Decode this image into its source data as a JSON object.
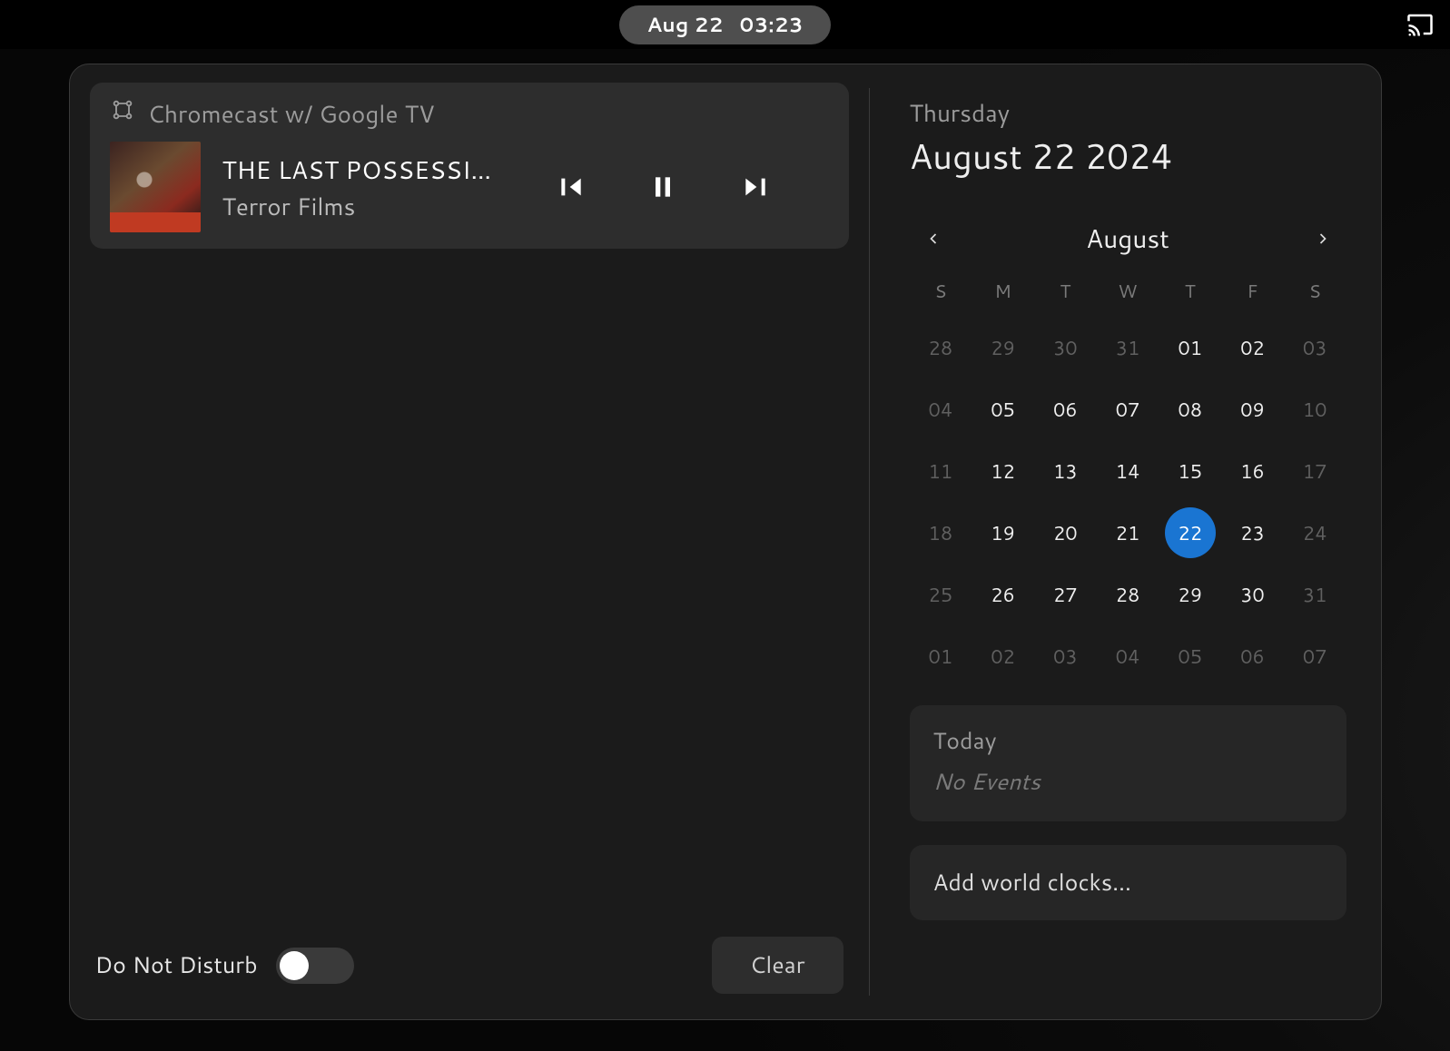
{
  "topbar": {
    "date": "Aug 22",
    "time": "03:23"
  },
  "media": {
    "source": "Chromecast w/ Google TV",
    "title": "THE LAST POSSESSIO…",
    "subtitle": "Terror Films"
  },
  "dnd": {
    "label": "Do Not Disturb",
    "enabled": false,
    "clear_label": "Clear"
  },
  "date_header": {
    "weekday": "Thursday",
    "full": "August 22 2024"
  },
  "calendar": {
    "month_label": "August",
    "dow": [
      "S",
      "M",
      "T",
      "W",
      "T",
      "F",
      "S"
    ],
    "weeks": [
      [
        {
          "n": "28",
          "cls": "other"
        },
        {
          "n": "29",
          "cls": "other"
        },
        {
          "n": "30",
          "cls": "other"
        },
        {
          "n": "31",
          "cls": "other"
        },
        {
          "n": "01",
          "cls": "in"
        },
        {
          "n": "02",
          "cls": "in"
        },
        {
          "n": "03",
          "cls": "weekend"
        }
      ],
      [
        {
          "n": "04",
          "cls": "weekend"
        },
        {
          "n": "05",
          "cls": "in"
        },
        {
          "n": "06",
          "cls": "in"
        },
        {
          "n": "07",
          "cls": "in"
        },
        {
          "n": "08",
          "cls": "in"
        },
        {
          "n": "09",
          "cls": "in"
        },
        {
          "n": "10",
          "cls": "weekend"
        }
      ],
      [
        {
          "n": "11",
          "cls": "weekend"
        },
        {
          "n": "12",
          "cls": "in"
        },
        {
          "n": "13",
          "cls": "in"
        },
        {
          "n": "14",
          "cls": "in"
        },
        {
          "n": "15",
          "cls": "in"
        },
        {
          "n": "16",
          "cls": "in"
        },
        {
          "n": "17",
          "cls": "weekend"
        }
      ],
      [
        {
          "n": "18",
          "cls": "weekend"
        },
        {
          "n": "19",
          "cls": "in"
        },
        {
          "n": "20",
          "cls": "in"
        },
        {
          "n": "21",
          "cls": "in"
        },
        {
          "n": "22",
          "cls": "in",
          "today": true
        },
        {
          "n": "23",
          "cls": "in"
        },
        {
          "n": "24",
          "cls": "weekend"
        }
      ],
      [
        {
          "n": "25",
          "cls": "weekend"
        },
        {
          "n": "26",
          "cls": "in"
        },
        {
          "n": "27",
          "cls": "in"
        },
        {
          "n": "28",
          "cls": "in"
        },
        {
          "n": "29",
          "cls": "in"
        },
        {
          "n": "30",
          "cls": "in"
        },
        {
          "n": "31",
          "cls": "weekend"
        }
      ],
      [
        {
          "n": "01",
          "cls": "other"
        },
        {
          "n": "02",
          "cls": "other"
        },
        {
          "n": "03",
          "cls": "other"
        },
        {
          "n": "04",
          "cls": "other"
        },
        {
          "n": "05",
          "cls": "other"
        },
        {
          "n": "06",
          "cls": "other"
        },
        {
          "n": "07",
          "cls": "other"
        }
      ]
    ]
  },
  "events": {
    "title": "Today",
    "subtitle": "No Events"
  },
  "world_clocks": {
    "label": "Add world clocks…"
  }
}
